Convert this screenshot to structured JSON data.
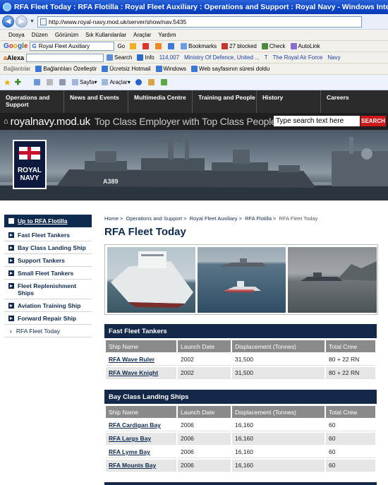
{
  "window": {
    "title": "RFA Fleet Today : RFA Flotilla : Royal Fleet Auxiliary : Operations and Support : Royal Navy - Windows Internet Explorer",
    "url": "http://www.royal-navy.mod.uk/server/show/nav.5435"
  },
  "menu": [
    "Dosya",
    "Düzen",
    "Görünüm",
    "Sık Kullanılanlar",
    "Araçlar",
    "Yardım"
  ],
  "google_toolbar": {
    "brand": "Google",
    "search_value": "Royal Fleet Auxiliary",
    "go_label": "Go",
    "bookmarks": "Bookmarks",
    "blocked": "27 blocked",
    "check": "Check",
    "autolink": "AutoLink"
  },
  "alexa_toolbar": {
    "brand": "Alexa",
    "search_label": "Search",
    "info_label": "Info",
    "count": "114,007",
    "links": [
      "Ministry Of Defence, United ...",
      "T",
      "The Royal Air Force",
      "Navy"
    ]
  },
  "links_bar": {
    "label": "Bağlantılar",
    "items": [
      "Bağlantıları Özelleştir",
      "Ücretsiz Hotmail",
      "Windows",
      "Web sayfasının süresi doldu"
    ]
  },
  "command_bar": {
    "page_label": "Sayfa",
    "tools_label": "Araçlar"
  },
  "site_nav": [
    "Operations and Support",
    "News and Events",
    "Multimedia Centre",
    "Training and People",
    "History",
    "Careers"
  ],
  "brand": {
    "site_name": "royalnavy.mod.uk",
    "tagline": "Top Class Employer with Top Class People",
    "search_placeholder": "Type search text here",
    "search_button": "SEARCH",
    "logo_text_1": "ROYAL",
    "logo_text_2": "NAVY",
    "ship_pennant": "A389"
  },
  "sidebar": {
    "top": "Up to RFA Flotilla",
    "items": [
      "Fast Fleet Tankers",
      "Bay Class Landing Ship",
      "Support Tankers",
      "Small Fleet Tankers",
      "Fleet Replenishment Ships",
      "Aviation Training Ship",
      "Forward Repair Ship"
    ],
    "current": "RFA Fleet Today"
  },
  "breadcrumb": [
    "Home",
    "Operations and Support",
    "Royal Fleet Auxiliary",
    "RFA Flotilla",
    "RFA Fleet Today"
  ],
  "page_title": "RFA Fleet Today",
  "sections": [
    {
      "title": "Fast Fleet Tankers",
      "columns": [
        "Ship Name",
        "Launch Date",
        "Displacement (Tonnes)",
        "Total Crew"
      ],
      "rows": [
        [
          "RFA Wave Ruler",
          "2002",
          "31,500",
          "80 + 22 RN"
        ],
        [
          "RFA Wave Knight",
          "2002",
          "31,500",
          "80 + 22 RN"
        ]
      ]
    },
    {
      "title": "Bay Class Landing Ships",
      "columns": [
        "Ship Name",
        "Launch Date",
        "Displacement (Tonnes)",
        "Total Crew"
      ],
      "rows": [
        [
          "RFA Cardigan Bay",
          "2006",
          "16,160",
          "60"
        ],
        [
          "RFA Largs Bay",
          "2006",
          "16,160",
          "60"
        ],
        [
          "RFA Lyme Bay",
          "2006",
          "16,160",
          "60"
        ],
        [
          "RFA Mounts Bay",
          "2006",
          "16,160",
          "60"
        ]
      ]
    }
  ],
  "colors": {
    "nav_dark": "#2b2b2b",
    "navy": "#0f2a4f",
    "section_head": "#14284a",
    "search_red": "#cc1a1a"
  }
}
